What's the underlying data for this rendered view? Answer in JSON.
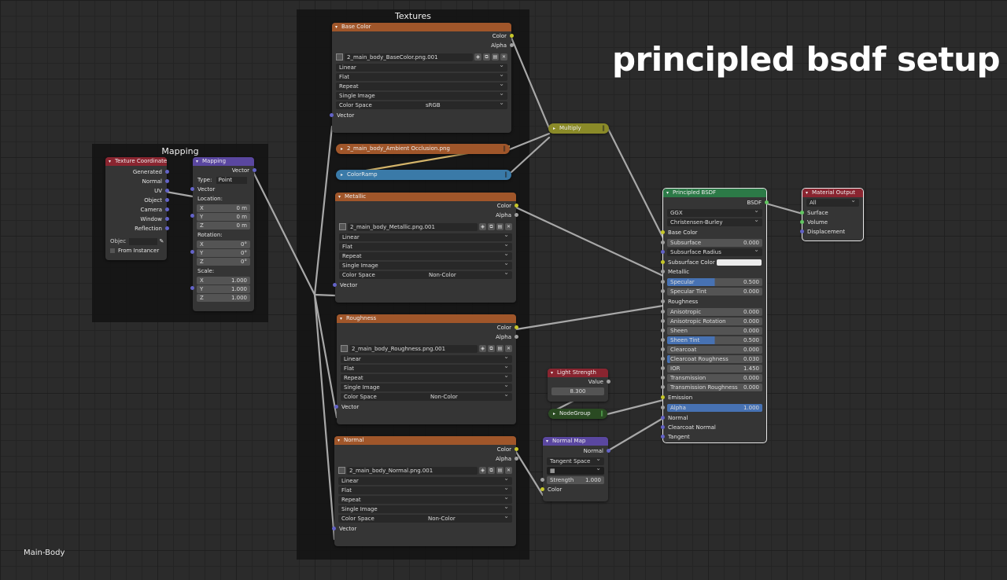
{
  "title": "principled bsdf setup",
  "footer_label": "Main-Body",
  "frames": {
    "mapping_title": "Mapping",
    "textures_title": "Textures"
  },
  "texture_coordinate": {
    "header": "Texture Coordinate",
    "outputs": [
      "Generated",
      "Normal",
      "UV",
      "Object",
      "Camera",
      "Window",
      "Reflection"
    ],
    "object_label": "Objec",
    "from_instancer": "From Instancer"
  },
  "mapping": {
    "header": "Mapping",
    "output": "Vector",
    "type_label": "Type:",
    "type_value": "Point",
    "vector_label": "Vector",
    "location_label": "Location:",
    "rotation_label": "Rotation:",
    "scale_label": "Scale:",
    "location": [
      {
        "axis": "X",
        "value": "0 m"
      },
      {
        "axis": "Y",
        "value": "0 m"
      },
      {
        "axis": "Z",
        "value": "0 m"
      }
    ],
    "rotation": [
      {
        "axis": "X",
        "value": "0°"
      },
      {
        "axis": "Y",
        "value": "0°"
      },
      {
        "axis": "Z",
        "value": "0°"
      }
    ],
    "scale": [
      {
        "axis": "X",
        "value": "1.000"
      },
      {
        "axis": "Y",
        "value": "1.000"
      },
      {
        "axis": "Z",
        "value": "1.000"
      }
    ]
  },
  "image_nodes": [
    {
      "header": "Base Color",
      "image": "2_main_body_BaseColor.png.001",
      "interpolation": "Linear",
      "projection": "Flat",
      "extension": "Repeat",
      "source": "Single Image",
      "colorspace_label": "Color Space",
      "colorspace": "sRGB",
      "out_color": "Color",
      "out_alpha": "Alpha",
      "in_vector": "Vector"
    },
    {
      "header": "Metallic",
      "image": "2_main_body_Metallic.png.001",
      "interpolation": "Linear",
      "projection": "Flat",
      "extension": "Repeat",
      "source": "Single Image",
      "colorspace_label": "Color Space",
      "colorspace": "Non-Color",
      "out_color": "Color",
      "out_alpha": "Alpha",
      "in_vector": "Vector"
    },
    {
      "header": "Roughness",
      "image": "2_main_body_Roughness.png.001",
      "interpolation": "Linear",
      "projection": "Flat",
      "extension": "Repeat",
      "source": "Single Image",
      "colorspace_label": "Color Space",
      "colorspace": "Non-Color",
      "out_color": "Color",
      "out_alpha": "Alpha",
      "in_vector": "Vector"
    },
    {
      "header": "Normal",
      "image": "2_main_body_Normal.png.001",
      "interpolation": "Linear",
      "projection": "Flat",
      "extension": "Repeat",
      "source": "Single Image",
      "colorspace_label": "Color Space",
      "colorspace": "Non-Color",
      "out_color": "Color",
      "out_alpha": "Alpha",
      "in_vector": "Vector"
    }
  ],
  "collapsed": {
    "ao": "2_main_body_Ambient Occlusion.png",
    "colorramp": "ColorRamp",
    "multiply": "Multiply",
    "nodegroup": "NodeGroup"
  },
  "light_strength": {
    "header": "Light Strength",
    "output": "Value",
    "value": "8.300"
  },
  "normal_map": {
    "header": "Normal Map",
    "output": "Normal",
    "space": "Tangent Space",
    "strength_label": "Strength",
    "strength": "1.000",
    "color_label": "Color"
  },
  "principled": {
    "header": "Principled BSDF",
    "output": "BSDF",
    "distribution": "GGX",
    "subsurface_method": "Christensen-Burley",
    "inputs": [
      {
        "label": "Base Color",
        "kind": "socket"
      },
      {
        "label": "Subsurface",
        "kind": "value",
        "value": "0.000",
        "fill": 0
      },
      {
        "label": "Subsurface Radius",
        "kind": "dropdown"
      },
      {
        "label": "Subsurface Color",
        "kind": "color"
      },
      {
        "label": "Metallic",
        "kind": "socket"
      },
      {
        "label": "Specular",
        "kind": "value",
        "value": "0.500",
        "fill": 0.5
      },
      {
        "label": "Specular Tint",
        "kind": "value",
        "value": "0.000",
        "fill": 0
      },
      {
        "label": "Roughness",
        "kind": "socket"
      },
      {
        "label": "Anisotropic",
        "kind": "value",
        "value": "0.000",
        "fill": 0
      },
      {
        "label": "Anisotropic Rotation",
        "kind": "value",
        "value": "0.000",
        "fill": 0
      },
      {
        "label": "Sheen",
        "kind": "value",
        "value": "0.000",
        "fill": 0
      },
      {
        "label": "Sheen Tint",
        "kind": "value",
        "value": "0.500",
        "fill": 0.5
      },
      {
        "label": "Clearcoat",
        "kind": "value",
        "value": "0.000",
        "fill": 0
      },
      {
        "label": "Clearcoat Roughness",
        "kind": "value",
        "value": "0.030",
        "fill": 0.03
      },
      {
        "label": "IOR",
        "kind": "value",
        "value": "1.450",
        "fill": 0
      },
      {
        "label": "Transmission",
        "kind": "value",
        "value": "0.000",
        "fill": 0
      },
      {
        "label": "Transmission Roughness",
        "kind": "value",
        "value": "0.000",
        "fill": 0
      },
      {
        "label": "Emission",
        "kind": "socket"
      },
      {
        "label": "Alpha",
        "kind": "value",
        "value": "1.000",
        "fill": 1
      },
      {
        "label": "Normal",
        "kind": "socket"
      },
      {
        "label": "Clearcoat Normal",
        "kind": "socket"
      },
      {
        "label": "Tangent",
        "kind": "socket"
      }
    ]
  },
  "material_output": {
    "header": "Material Output",
    "target": "All",
    "inputs": [
      "Surface",
      "Volume",
      "Displacement"
    ]
  },
  "colors": {
    "texture_header": "#a0562a",
    "shader_header": "#2c7a47",
    "vector_header": "#5a47a0",
    "input_header": "#8a2530",
    "wire": "#a8a8a8",
    "colorramp": "#3a7aa8",
    "multiply": "#8a8a28",
    "nodegroup": "#2a4a22"
  }
}
